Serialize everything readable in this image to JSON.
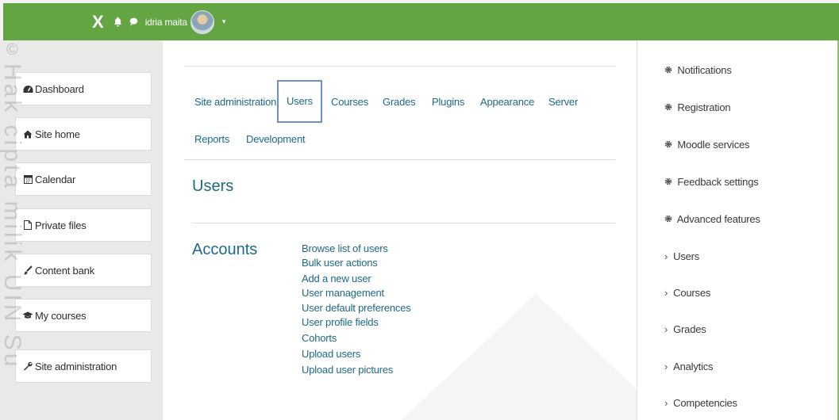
{
  "topbar": {
    "close_glyph": "X",
    "bell_icon": "bell-icon",
    "chat_icon": "chat-icon",
    "user_name": "idria maita",
    "caret": "▾",
    "bg_color": "#63a543"
  },
  "sidebar": {
    "items": [
      {
        "label": "Dashboard",
        "icon": "dashboard-icon"
      },
      {
        "label": "Site home",
        "icon": "home-icon"
      },
      {
        "label": "Calendar",
        "icon": "calendar-icon"
      },
      {
        "label": "Private files",
        "icon": "file-icon"
      },
      {
        "label": "Content bank",
        "icon": "brush-icon"
      },
      {
        "label": "My courses",
        "icon": "graduation-cap-icon"
      },
      {
        "label": "Site administration",
        "icon": "wrench-icon"
      }
    ]
  },
  "watermark": {
    "text": "Hak cipta milik UIN Su",
    "symbol": "©"
  },
  "admin_tabs": {
    "row1": [
      "Site administration",
      "Users",
      "Courses",
      "Grades",
      "Plugins",
      "Appearance",
      "Server"
    ],
    "row2": [
      "Reports",
      "Development"
    ],
    "active": "Users"
  },
  "page": {
    "heading": "Users",
    "section": "Accounts",
    "links": [
      "Browse list of users",
      "Bulk user actions",
      "Add a new user",
      "User management",
      "User default preferences",
      "User profile fields",
      "Cohorts",
      "Upload users",
      "Upload user pictures"
    ]
  },
  "right_panel": {
    "settings": [
      "Notifications",
      "Registration",
      "Moodle services",
      "Feedback settings",
      "Advanced features"
    ],
    "categories": [
      "Users",
      "Courses",
      "Grades",
      "Analytics",
      "Competencies"
    ]
  },
  "colors": {
    "accent": "#63a543",
    "link": "#1d6a8a",
    "active_tab_border": "#6a8fc2"
  }
}
